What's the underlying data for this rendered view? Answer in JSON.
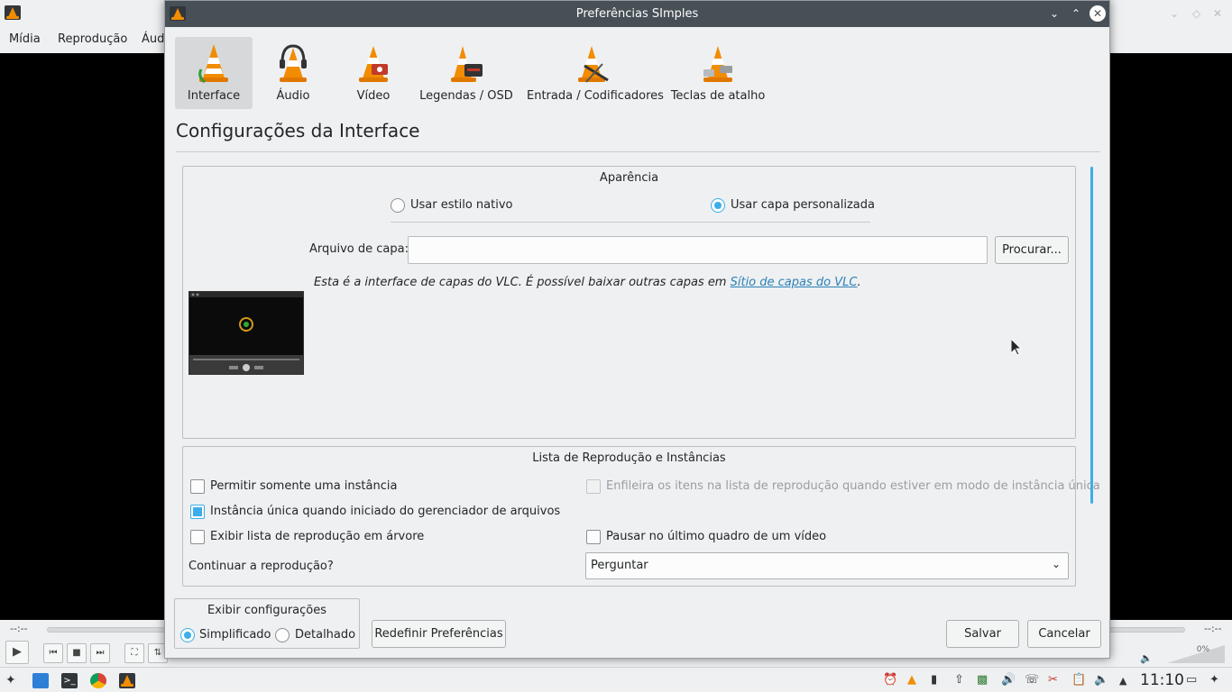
{
  "vlc": {
    "menu": [
      "Mídia",
      "Reprodução",
      "Áud"
    ],
    "time_left": "--:--",
    "time_right": "--:--",
    "volume": "0%"
  },
  "dialog": {
    "title": "Preferências SImples",
    "categories": [
      {
        "label": "Interface",
        "icon": "interface-cone-icon",
        "selected": true
      },
      {
        "label": "Áudio",
        "icon": "audio-headphones-cone-icon",
        "selected": false
      },
      {
        "label": "Vídeo",
        "icon": "video-cone-icon",
        "selected": false
      },
      {
        "label": "Legendas / OSD",
        "icon": "subtitles-cone-icon",
        "selected": false
      },
      {
        "label": "Entrada / Codificadores",
        "icon": "input-codecs-cone-icon",
        "selected": false
      },
      {
        "label": "Teclas de atalho",
        "icon": "hotkeys-cone-icon",
        "selected": false
      }
    ],
    "section_title": "Configurações da Interface",
    "appearance": {
      "title": "Aparência",
      "native_style": "Usar estilo nativo",
      "custom_skin": "Usar capa personalizada",
      "selected": "custom_skin",
      "skin_file_label": "Arquivo de capa:",
      "skin_file_value": "",
      "browse": "Procurar...",
      "note_prefix": "Esta é a interface de capas do VLC. É possível baixar outras capas em ",
      "note_link": "Sítio de capas do VLC",
      "note_suffix": "."
    },
    "playlist": {
      "title": "Lista de Reprodução e Instâncias",
      "one_instance": {
        "label": "Permitir somente uma instância",
        "checked": false
      },
      "enqueue": {
        "label": "Enfileira os itens na lista de reprodução quando estiver em modo de instância única",
        "checked": false,
        "enabled": false
      },
      "one_instance_fm": {
        "label": "Instância única quando iniciado do gerenciador de arquivos",
        "checked": true
      },
      "tree_playlist": {
        "label": "Exibir lista de reprodução em árvore",
        "checked": false
      },
      "pause_last_frame": {
        "label": "Pausar no último quadro de um vídeo",
        "checked": false
      },
      "resume_label": "Continuar a reprodução?",
      "resume_value": "Perguntar"
    },
    "show_settings": {
      "title": "Exibir configurações",
      "simple": "Simplificado",
      "detailed": "Detalhado",
      "selected": "simple"
    },
    "reset": "Redefinir Preferências",
    "save": "Salvar",
    "cancel": "Cancelar"
  },
  "taskbar": {
    "clock": "11:10"
  },
  "colors": {
    "accent": "#3daee9",
    "titlebar": "#475057",
    "window_bg": "#eff0f1",
    "cone": "#f28c00"
  }
}
